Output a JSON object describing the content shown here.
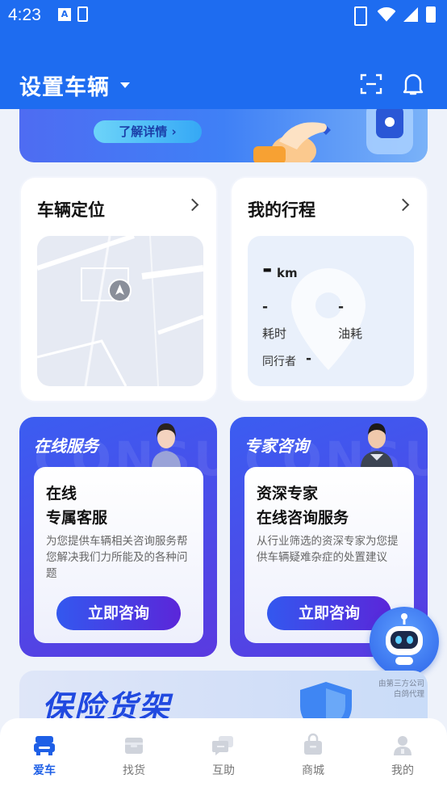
{
  "status_bar": {
    "time": "4:23"
  },
  "header": {
    "title": "设置车辆"
  },
  "banner": {
    "button_label": "了解详情"
  },
  "vehicle_card": {
    "title": "车辆定位"
  },
  "trip_card": {
    "title": "我的行程",
    "distance_value": "-",
    "distance_unit": "km",
    "duration_value": "-",
    "duration_label": "耗时",
    "fuel_value": "-",
    "fuel_label": "油耗",
    "companion_label": "同行者",
    "companion_value": "-"
  },
  "service_cards": [
    {
      "header": "在线服务",
      "watermark": "CONSUL",
      "line1": "在线",
      "line2": "专属客服",
      "description": "为您提供车辆相关咨询服务帮您解决我们力所能及的各种问题",
      "button": "立即咨询"
    },
    {
      "header": "专家咨询",
      "watermark": "CONSUL",
      "line1": "资深专家",
      "line2": "在线咨询服务",
      "description": "从行业筛选的资深专家为您提供车辆疑难杂症的处置建议",
      "button": "立即咨询"
    }
  ],
  "insurance": {
    "title": "保险货架",
    "note_line1": "由第三方公司",
    "note_line2": "白鸽代理"
  },
  "bottom_nav": [
    {
      "label": "爱车",
      "icon": "car-icon",
      "active": true
    },
    {
      "label": "找货",
      "icon": "box-icon",
      "active": false
    },
    {
      "label": "互助",
      "icon": "chat-icon",
      "active": false
    },
    {
      "label": "商城",
      "icon": "shopping-bag-icon",
      "active": false
    },
    {
      "label": "我的",
      "icon": "person-icon",
      "active": false
    }
  ],
  "colors": {
    "primary": "#1e6cf0",
    "accent_purple": "#5a3ae0",
    "nav_active": "#1e5fe6"
  }
}
